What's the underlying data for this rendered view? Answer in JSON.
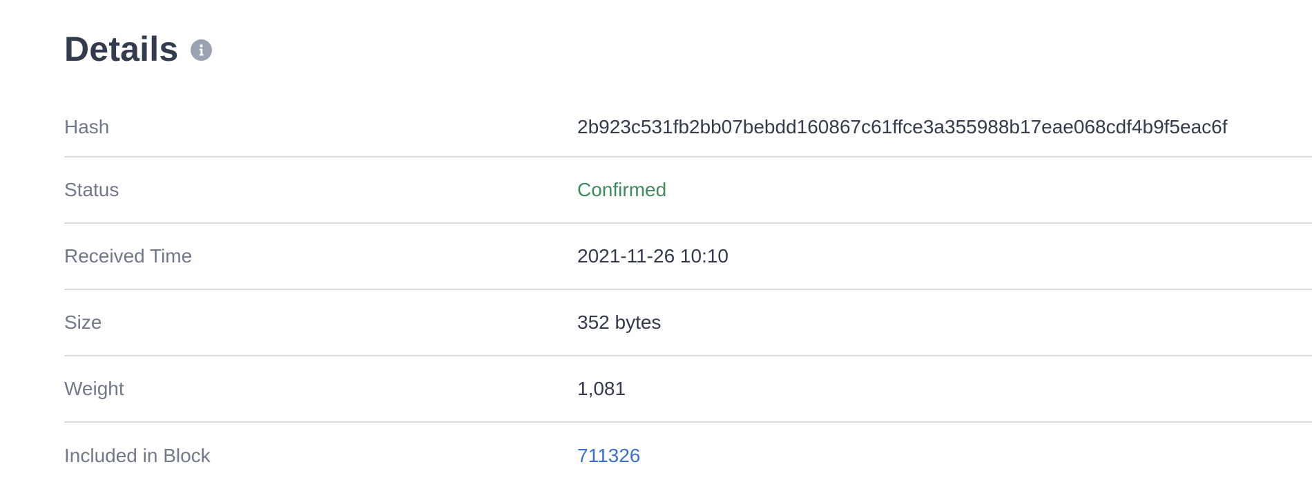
{
  "header": {
    "title": "Details",
    "info_icon": "info-icon"
  },
  "rows": [
    {
      "label": "Hash",
      "value": "2b923c531fb2bb07bebdd160867c61ffce3a355988b17eae068cdf4b9f5eac6f"
    },
    {
      "label": "Status",
      "value": "Confirmed"
    },
    {
      "label": "Received Time",
      "value": "2021-11-26 10:10"
    },
    {
      "label": "Size",
      "value": "352 bytes"
    },
    {
      "label": "Weight",
      "value": "1,081"
    },
    {
      "label": "Included in Block",
      "value": "711326"
    }
  ],
  "colors": {
    "status_confirmed": "#3f8a5f",
    "link": "#3a6fd0"
  }
}
